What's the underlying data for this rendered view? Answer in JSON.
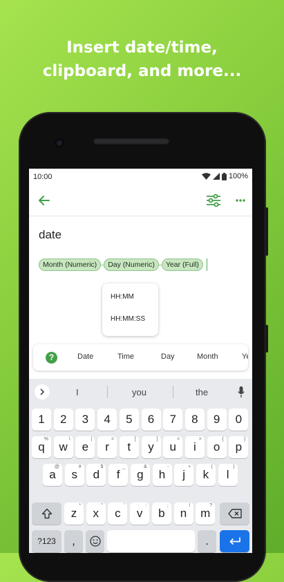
{
  "headline": {
    "line1": "Insert date/time,",
    "line2": "clipboard, and more..."
  },
  "status_bar": {
    "time": "10:00",
    "battery": "100%"
  },
  "app_bar": {
    "back_icon": "arrow-left-icon",
    "settings_icon": "sliders-icon",
    "more_icon": "more-horizontal-icon"
  },
  "note": {
    "title": "date"
  },
  "chips": [
    "Month (Numeric)",
    "Day (Numeric)",
    "Year (Full)"
  ],
  "time_formats": [
    "HH:MM",
    "HH:MM:SS"
  ],
  "suggestion_bar": {
    "help_label": "?",
    "options": [
      "Date",
      "Time",
      "Day",
      "Month",
      "Ye"
    ]
  },
  "keyboard": {
    "predictions": [
      "I",
      "you",
      "the"
    ],
    "numbers": [
      "1",
      "2",
      "3",
      "4",
      "5",
      "6",
      "7",
      "8",
      "9",
      "0"
    ],
    "row1": [
      [
        "q",
        "%"
      ],
      [
        "w",
        "\\"
      ],
      [
        "e",
        "|"
      ],
      [
        "r",
        "="
      ],
      [
        "t",
        "["
      ],
      [
        "y",
        "]"
      ],
      [
        "u",
        "<"
      ],
      [
        "i",
        ">"
      ],
      [
        "o",
        "{"
      ],
      [
        "p",
        "}"
      ]
    ],
    "row2": [
      [
        "a",
        "@"
      ],
      [
        "s",
        "#"
      ],
      [
        "d",
        "$"
      ],
      [
        "f",
        "_"
      ],
      [
        "g",
        "&"
      ],
      [
        "h",
        "-"
      ],
      [
        "j",
        "+"
      ],
      [
        "k",
        "("
      ],
      [
        "l",
        ")"
      ]
    ],
    "row3": [
      [
        "z",
        "*"
      ],
      [
        "x",
        "\""
      ],
      [
        "c",
        "'"
      ],
      [
        "v",
        ":"
      ],
      [
        "b",
        ";"
      ],
      [
        "n",
        "!"
      ],
      [
        "m",
        "?"
      ]
    ],
    "symbols_label": "?123",
    "comma": ",",
    "period": ".",
    "emoji_icon": "emoji-icon",
    "enter_icon": "enter-icon"
  },
  "colors": {
    "accent": "#43a047",
    "chip_bg": "#c8e6c0",
    "enter_key": "#1a73e8"
  }
}
